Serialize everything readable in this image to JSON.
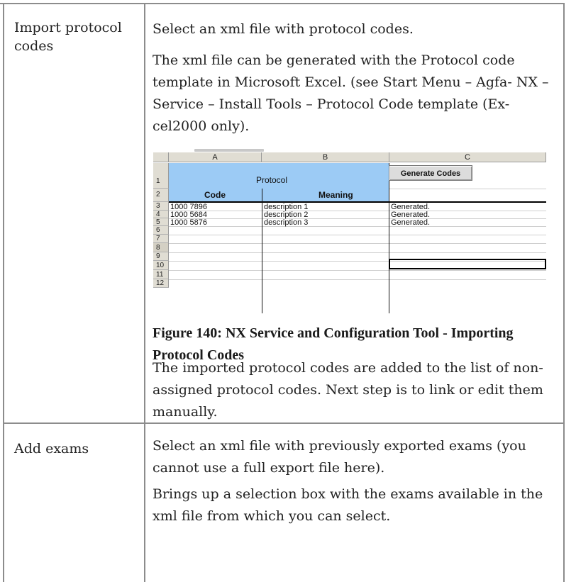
{
  "rows": [
    {
      "term": "Import protocol codes",
      "paragraphs": [
        "Select an xml file with protocol codes.",
        "The xml file can be generated with the Protocol code template in Microsoft Excel. (see Start Menu – Agfa- NX – Service – Install Tools – Protocol Code template (Ex-cel2000 only).",
        "The imported protocol codes are added to the list of non-assigned protocol codes. Next step is to link or edit them manually."
      ],
      "figure_caption": "Figure 140: NX Service and Configuration Tool - Importing Protocol Codes"
    },
    {
      "term": "Add exams",
      "paragraphs": [
        "Select an xml file with previously exported exams (you cannot use a full export file here).",
        "Brings up a selection box with the exams available in the xml file from which you can select."
      ]
    }
  ],
  "spreadsheet": {
    "columns": [
      "A",
      "B",
      "C"
    ],
    "row_numbers": [
      "1",
      "2",
      "3",
      "4",
      "5",
      "6",
      "7",
      "8",
      "9",
      "10",
      "11",
      "12"
    ],
    "header_title": "Protocol",
    "header_code": "Code",
    "header_meaning": "Meaning",
    "button_label": "Generate Codes",
    "data_rows": [
      {
        "code": "1000 7896",
        "meaning": "description 1",
        "status": "Generated."
      },
      {
        "code": "1000 5684",
        "meaning": "description 2",
        "status": "Generated."
      },
      {
        "code": "1000 5876",
        "meaning": "description 3",
        "status": "Generated."
      }
    ],
    "colors": {
      "header_fill": "#9ccbf5",
      "chrome": "#e0ddd3"
    }
  }
}
